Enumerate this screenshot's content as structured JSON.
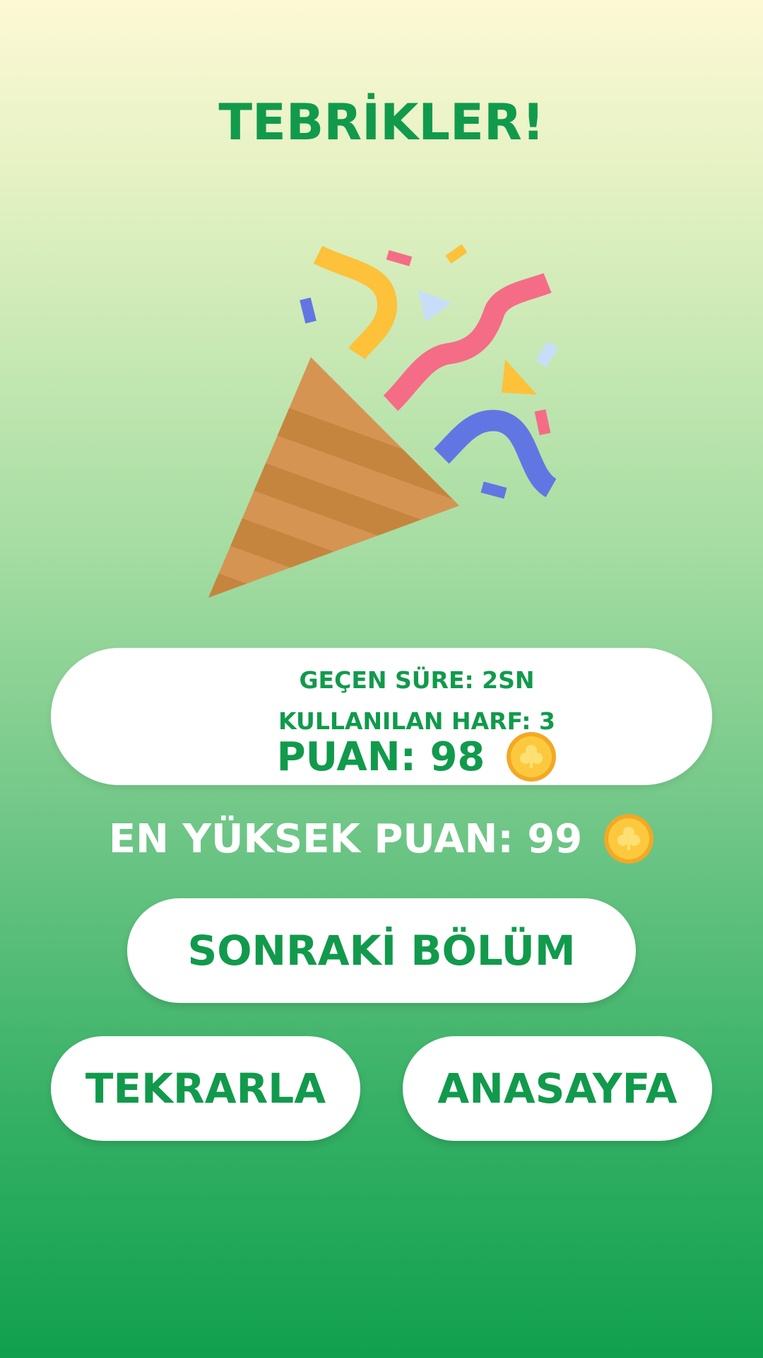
{
  "title": "TEBRİKLER!",
  "result": {
    "elapsed_time": "GEÇEN SÜRE: 2SN",
    "letters_used": "KULLANILAN HARF: 3",
    "score": "PUAN: 98"
  },
  "high_score": "EN YÜKSEK PUAN: 99",
  "buttons": {
    "next_level": "SONRAKİ BÖLÜM",
    "retry": "TEKRARLA",
    "home": "ANASAYFA"
  },
  "icons": {
    "celebration": "party-popper-icon",
    "coin": "clover-coin-icon"
  },
  "colors": {
    "accent_green": "#119a4c",
    "card_white": "#ffffff",
    "coin_gold": "#f6b832"
  }
}
